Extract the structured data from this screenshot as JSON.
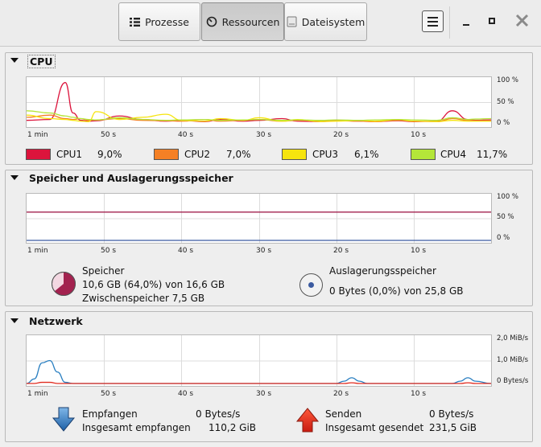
{
  "header": {
    "tabs": [
      {
        "label": "Prozesse",
        "icon": "list-icon"
      },
      {
        "label": "Ressourcen",
        "icon": "gauge-icon"
      },
      {
        "label": "Dateisystem",
        "icon": "drive-icon"
      }
    ],
    "active_tab": "Ressourcen"
  },
  "cpu": {
    "title": "CPU",
    "x_ticks": [
      "1 min",
      "50 s",
      "40 s",
      "30 s",
      "20 s",
      "10 s"
    ],
    "y_ticks": [
      "100 %",
      "50 %",
      "0 %"
    ],
    "cores": [
      {
        "name": "CPU1",
        "value": "9,0%",
        "color": "#dc143c"
      },
      {
        "name": "CPU2",
        "value": "7,0%",
        "color": "#f58025"
      },
      {
        "name": "CPU3",
        "value": "6,1%",
        "color": "#f6e40e"
      },
      {
        "name": "CPU4",
        "value": "11,7%",
        "color": "#b4e639"
      }
    ]
  },
  "memory": {
    "title": "Speicher und Auslagerungsspeicher",
    "x_ticks": [
      "1 min",
      "50 s",
      "40 s",
      "30 s",
      "20 s",
      "10 s"
    ],
    "y_ticks": [
      "100 %",
      "50 %",
      "0 %"
    ],
    "ram_label": "Speicher",
    "ram_value": "10,6 GB (64,0%) von 16,6 GB",
    "cache_value": "Zwischenspeicher 7,5 GB",
    "swap_label": "Auslagerungsspeicher",
    "swap_value": "0 Bytes (0,0%) von 25,8 GB",
    "ram_color": "#a3224f",
    "swap_color": "#3b5aa0"
  },
  "network": {
    "title": "Netzwerk",
    "x_ticks": [
      "1 min",
      "50 s",
      "40 s",
      "30 s",
      "20 s",
      "10 s"
    ],
    "y_ticks": [
      "2,0 MiB/s",
      "1,0 MiB/s",
      "0 Bytes/s"
    ],
    "recv_label": "Empfangen",
    "recv_rate": "0 Bytes/s",
    "recv_total_label": "Insgesamt empfangen",
    "recv_total": "110,2 GiB",
    "send_label": "Senden",
    "send_rate": "0 Bytes/s",
    "send_total_label": "Insgesamt gesendet",
    "send_total": "231,5 GiB",
    "recv_color": "#2a7fc1",
    "send_color": "#e02a1e"
  },
  "chart_data": [
    {
      "type": "line",
      "title": "CPU",
      "x_unit": "seconds ago",
      "x": [
        60,
        57,
        55,
        54,
        53,
        52,
        51,
        48,
        45,
        42,
        40,
        37,
        35,
        32,
        30,
        27,
        25,
        22,
        20,
        17,
        15,
        12,
        10,
        7,
        5,
        3,
        2,
        0
      ],
      "ylim": [
        0,
        100
      ],
      "series": [
        {
          "name": "CPU1",
          "values": [
            8,
            10,
            95,
            25,
            8,
            6,
            7,
            18,
            10,
            6,
            8,
            5,
            10,
            6,
            8,
            12,
            6,
            5,
            8,
            6,
            5,
            7,
            5,
            6,
            30,
            10,
            8,
            9
          ]
        },
        {
          "name": "CPU2",
          "values": [
            15,
            20,
            12,
            10,
            12,
            8,
            9,
            12,
            8,
            7,
            6,
            10,
            6,
            8,
            10,
            6,
            8,
            6,
            7,
            6,
            5,
            8,
            6,
            5,
            12,
            8,
            7,
            7
          ]
        },
        {
          "name": "CPU3",
          "values": [
            20,
            12,
            10,
            8,
            6,
            5,
            28,
            10,
            15,
            22,
            8,
            6,
            12,
            8,
            14,
            6,
            10,
            5,
            6,
            8,
            6,
            10,
            6,
            5,
            8,
            6,
            6,
            6
          ]
        },
        {
          "name": "CPU4",
          "values": [
            30,
            25,
            18,
            15,
            12,
            10,
            9,
            14,
            10,
            8,
            9,
            10,
            8,
            9,
            10,
            8,
            9,
            8,
            9,
            8,
            9,
            10,
            9,
            8,
            14,
            10,
            11,
            12
          ]
        }
      ]
    },
    {
      "type": "line",
      "title": "Speicher und Auslagerungsspeicher",
      "x_unit": "seconds ago",
      "x": [
        60,
        0
      ],
      "ylim": [
        0,
        100
      ],
      "series": [
        {
          "name": "Speicher",
          "values": [
            64,
            64
          ]
        },
        {
          "name": "Auslagerungsspeicher",
          "values": [
            0,
            0
          ]
        }
      ]
    },
    {
      "type": "line",
      "title": "Netzwerk",
      "x_unit": "seconds ago",
      "x": [
        60,
        59,
        58,
        57,
        56,
        55,
        54,
        20,
        19,
        18,
        17,
        16,
        5,
        4,
        3,
        2,
        0
      ],
      "ylim": [
        0,
        2.0
      ],
      "series": [
        {
          "name": "Empfangen",
          "values": [
            0,
            0.2,
            0.9,
            1.0,
            0.5,
            0.05,
            0,
            0,
            0.1,
            0.25,
            0.1,
            0,
            0,
            0.1,
            0.25,
            0.1,
            0
          ]
        },
        {
          "name": "Senden",
          "values": [
            0,
            0,
            0.05,
            0.05,
            0,
            0,
            0,
            0,
            0,
            0.03,
            0,
            0,
            0,
            0,
            0.03,
            0,
            0
          ]
        }
      ]
    }
  ]
}
